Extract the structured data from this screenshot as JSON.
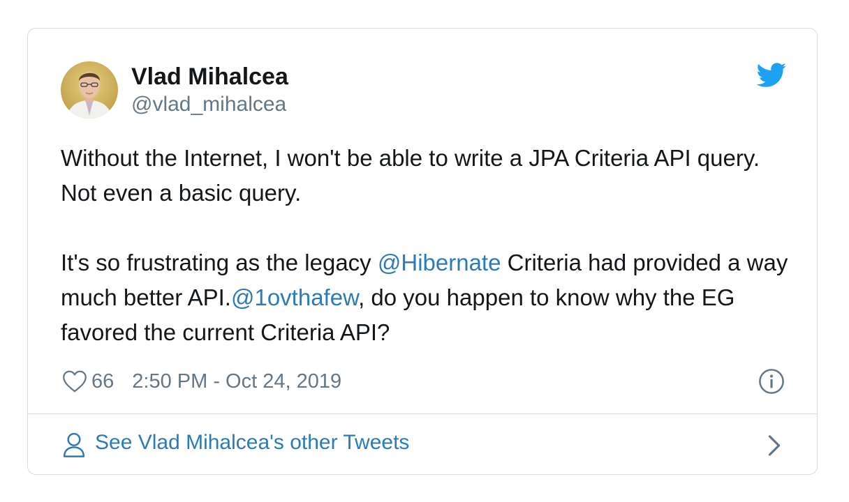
{
  "author": {
    "name": "Vlad Mihalcea",
    "handle": "@vlad_mihalcea"
  },
  "tweet": {
    "paragraph1": "Without the Internet, I won't be able to write a JPA Criteria API query. Not even a basic query.",
    "p2_before": "It's so frustrating as the legacy ",
    "mention1": "@Hibernate",
    "p2_middle": " Criteria had provided a way much better API.",
    "mention2": "@1ovthafew",
    "p2_after": ", do you happen to know why the EG favored the current Criteria API?"
  },
  "meta": {
    "likes": "66",
    "timestamp": "2:50 PM - Oct 24, 2019"
  },
  "footer": {
    "label": "See Vlad Mihalcea's other Tweets"
  },
  "icons": {
    "brand": "twitter-bird-icon",
    "like": "heart-icon",
    "info": "info-icon",
    "profile": "person-icon",
    "more": "chevron-right-icon"
  },
  "colors": {
    "brand_blue": "#1da1f2",
    "link_blue": "#2b7bb9",
    "text": "#14171a",
    "muted": "#657786",
    "border": "#d6dde3"
  }
}
